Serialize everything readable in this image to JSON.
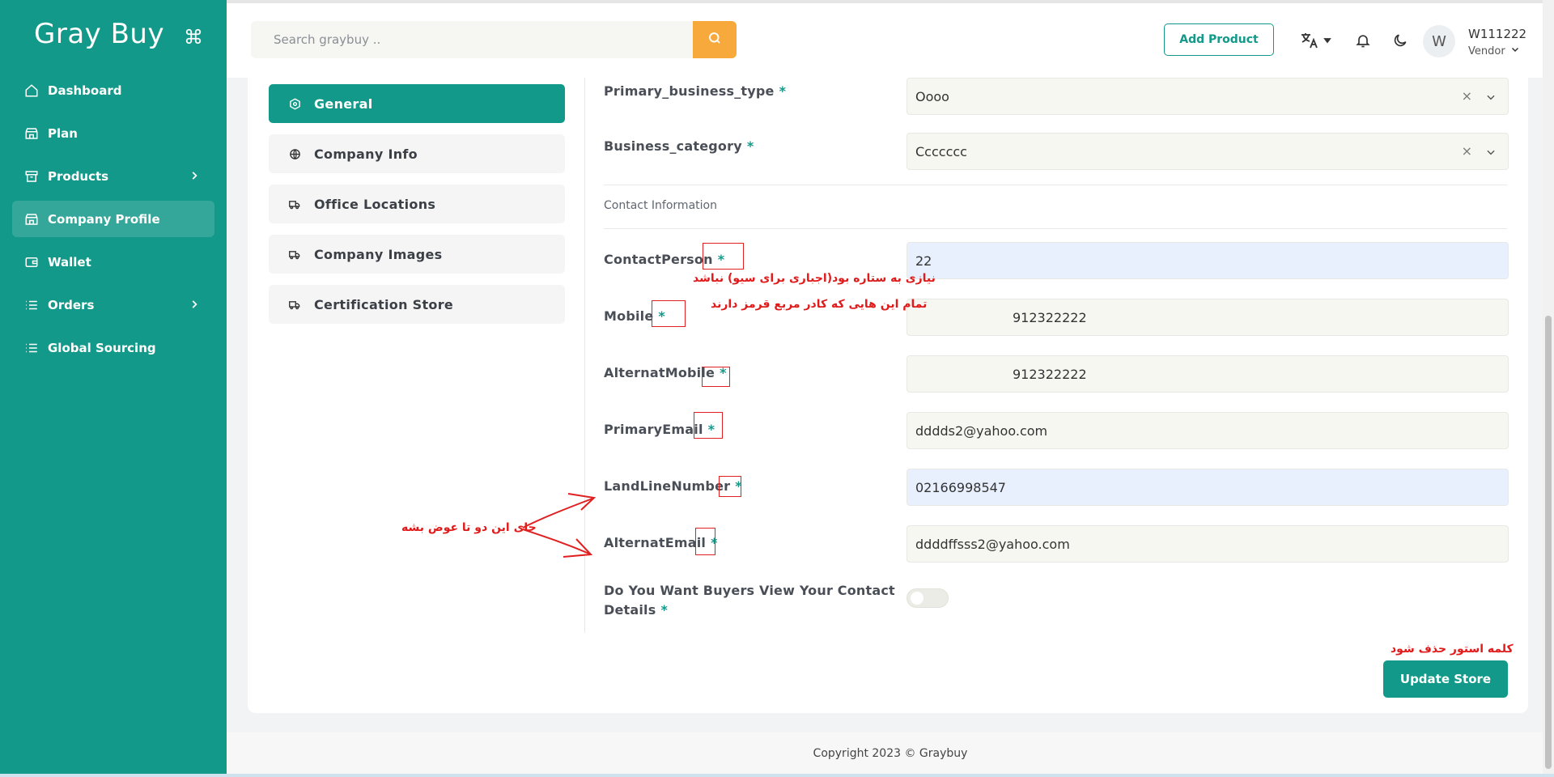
{
  "brand": {
    "name": "Gray Buy"
  },
  "sidebar": {
    "items": [
      {
        "label": "Dashboard",
        "icon": "home-icon"
      },
      {
        "label": "Plan",
        "icon": "store-icon"
      },
      {
        "label": "Products",
        "icon": "archive-icon"
      },
      {
        "label": "Company Profile",
        "icon": "store-icon"
      },
      {
        "label": "Wallet",
        "icon": "wallet-icon"
      },
      {
        "label": "Orders",
        "icon": "list-icon"
      },
      {
        "label": "Global Sourcing",
        "icon": "list-icon"
      }
    ],
    "active": "Company Profile"
  },
  "header": {
    "search_placeholder": "Search graybuy ..",
    "add_product_label": "Add Product",
    "avatar_initial": "W",
    "user_name": "W111222",
    "user_role": "Vendor"
  },
  "tabs": [
    {
      "label": "General",
      "icon": "settings-icon"
    },
    {
      "label": "Company Info",
      "icon": "globe-icon"
    },
    {
      "label": "Office Locations",
      "icon": "truck-icon"
    },
    {
      "label": "Company Images",
      "icon": "truck-icon"
    },
    {
      "label": "Certification Store",
      "icon": "truck-icon"
    }
  ],
  "form": {
    "primary_business_type": {
      "label": "Primary_business_type",
      "value": "Oooo"
    },
    "business_category": {
      "label": "Business_category",
      "value": "Ccccccc"
    },
    "section_title": "Contact Information",
    "contact_person": {
      "label": "ContactPerson",
      "value": "22"
    },
    "mobile": {
      "label": "Mobile",
      "value": "912322222"
    },
    "alternat_mobile": {
      "label": "AlternatMobile",
      "value": "912322222"
    },
    "primary_email": {
      "label": "PrimaryEmail",
      "value": "dddds2@yahoo.com"
    },
    "landline_number": {
      "label": "LandLineNumber",
      "value": "02166998547"
    },
    "alternate_email": {
      "label": "AlternatEmail",
      "value": "ddddffsss2@yahoo.com"
    },
    "view_contact": {
      "label_line1": "Do You Want Buyers View Your Contact",
      "label_line2": "Details"
    },
    "required_mark": "*",
    "clear_mark": "×",
    "update_label": "Update Store"
  },
  "annotations": {
    "note1": "نیازی به ستاره بود(اجباری برای سیو) نباشد",
    "note2": "تمام این هایی که کادر مربع قرمز دارند",
    "note3": "جای این دو تا عوض بشه",
    "note4": "کلمه استور حذف شود"
  },
  "footer": {
    "copyright": "Copyright 2023 © Graybuy"
  },
  "colors": {
    "primary": "#13998a",
    "search_button": "#f7a93c",
    "annotation": "#e02020"
  }
}
